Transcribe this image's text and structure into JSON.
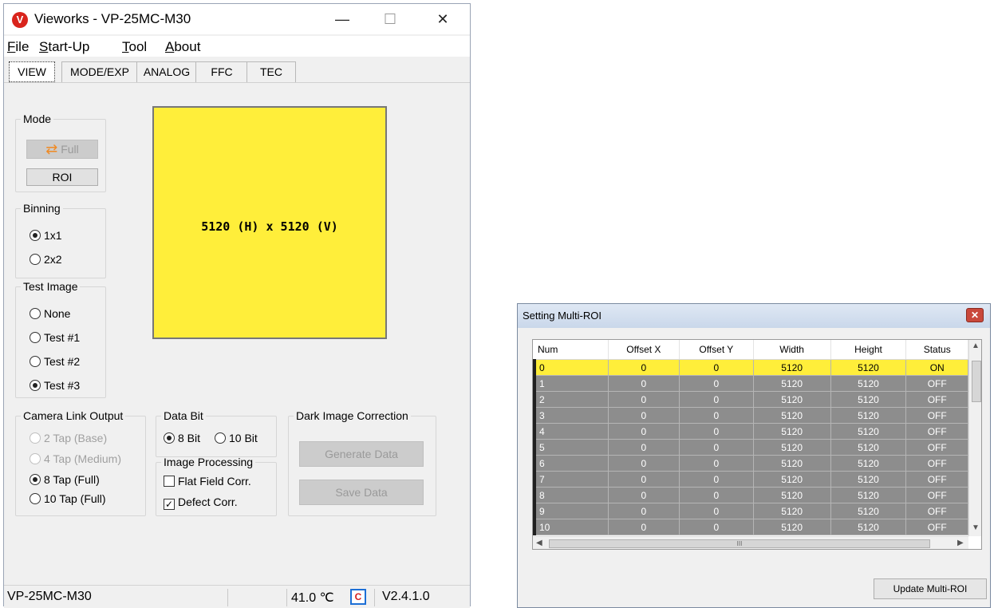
{
  "main_window": {
    "title": "Vieworks - VP-25MC-M30",
    "logo_letter": "V",
    "controls": {
      "minimize": "—",
      "maximize": "☐",
      "close": "✕"
    },
    "menu": {
      "file": {
        "accel": "F",
        "rest": "ile"
      },
      "startup": {
        "accel": "S",
        "rest": "tart-Up"
      },
      "tool": {
        "accel": "T",
        "rest": "ool"
      },
      "about": {
        "accel": "A",
        "rest": "bout"
      }
    },
    "tabs": [
      "VIEW",
      "MODE/EXP",
      "ANALOG",
      "FFC",
      "TEC"
    ],
    "mode": {
      "legend": "Mode",
      "full_button": "Full",
      "roi_button": "ROI"
    },
    "binning": {
      "legend": "Binning",
      "options": [
        "1x1",
        "2x2"
      ],
      "selected": "1x1"
    },
    "test_image": {
      "legend": "Test Image",
      "options": [
        "None",
        "Test #1",
        "Test #2",
        "Test #3"
      ],
      "selected": "Test #3"
    },
    "preview_text": "5120 (H) x 5120 (V)",
    "camera_link": {
      "legend": "Camera Link Output",
      "options": [
        "2 Tap (Base)",
        "4 Tap (Medium)",
        "8 Tap (Full)",
        "10 Tap (Full)"
      ],
      "selected": "8 Tap (Full)"
    },
    "data_bit": {
      "legend": "Data Bit",
      "options": [
        "8 Bit",
        "10 Bit"
      ],
      "selected": "8 Bit"
    },
    "image_processing": {
      "legend": "Image Processing",
      "flat_field": "Flat Field Corr.",
      "flat_field_checked": false,
      "defect": "Defect Corr.",
      "defect_checked": true
    },
    "dark_correction": {
      "legend": "Dark Image Correction",
      "generate": "Generate Data",
      "save": "Save Data"
    },
    "status": {
      "model": "VP-25MC-M30",
      "temperature": "41.0 ℃",
      "temp_icon_label": "C",
      "version": "V2.4.1.0"
    }
  },
  "roi_dialog": {
    "title": "Setting Multi-ROI",
    "close_glyph": "✕",
    "columns": [
      "Num",
      "Offset X",
      "Offset Y",
      "Width",
      "Height",
      "Status"
    ],
    "rows": [
      [
        "0",
        "0",
        "0",
        "5120",
        "5120",
        "ON"
      ],
      [
        "1",
        "0",
        "0",
        "5120",
        "5120",
        "OFF"
      ],
      [
        "2",
        "0",
        "0",
        "5120",
        "5120",
        "OFF"
      ],
      [
        "3",
        "0",
        "0",
        "5120",
        "5120",
        "OFF"
      ],
      [
        "4",
        "0",
        "0",
        "5120",
        "5120",
        "OFF"
      ],
      [
        "5",
        "0",
        "0",
        "5120",
        "5120",
        "OFF"
      ],
      [
        "6",
        "0",
        "0",
        "5120",
        "5120",
        "OFF"
      ],
      [
        "7",
        "0",
        "0",
        "5120",
        "5120",
        "OFF"
      ],
      [
        "8",
        "0",
        "0",
        "5120",
        "5120",
        "OFF"
      ],
      [
        "9",
        "0",
        "0",
        "5120",
        "5120",
        "OFF"
      ],
      [
        "10",
        "0",
        "0",
        "5120",
        "5120",
        "OFF"
      ]
    ],
    "selected_row": "0",
    "scroll_thumb_glyph": "III",
    "update_button": "Update Multi-ROI"
  },
  "colors": {
    "preview": "#ffee3a",
    "selected_row": "#ffee3a",
    "row_bg": "#8d8d8d",
    "logo": "#d9241c",
    "accent_arrow": "#f08a24"
  }
}
